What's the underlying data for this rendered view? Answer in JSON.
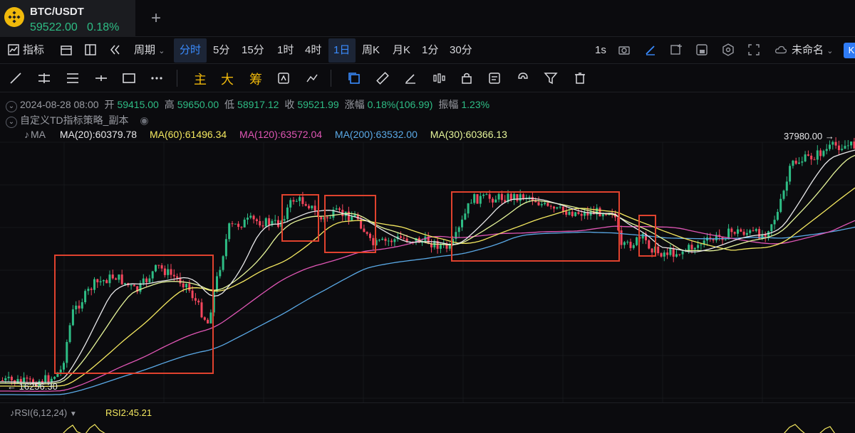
{
  "tab": {
    "symbol": "BTC/USDT",
    "price": "59522.00",
    "change": "0.18%",
    "add_label": "+"
  },
  "toolbar1": {
    "indicators": "指标",
    "period": "周期",
    "intervals": [
      "分时",
      "5分",
      "15分",
      "1时",
      "4时",
      "1日",
      "周K",
      "月K",
      "1分",
      "30分"
    ],
    "active_interval": "1日",
    "refresh": "1s",
    "layout_name": "未命名",
    "k_button": "K"
  },
  "toolbar2": {
    "main": "主",
    "big": "大",
    "chip": "筹"
  },
  "ohlc": {
    "date": "2024-08-28 08:00",
    "open_label": "开",
    "open": "59415.00",
    "high_label": "高",
    "high": "59650.00",
    "low_label": "低",
    "low": "58917.12",
    "close_label": "收",
    "close": "59521.99",
    "change_label": "涨幅",
    "change": "0.18%(106.99)",
    "amp_label": "振幅",
    "amp": "1.23%"
  },
  "strategy": {
    "name": "自定义TD指标策略_副本"
  },
  "ma": {
    "label": "MA",
    "ma20": "MA(20):60379.78",
    "ma60": "MA(60):61496.34",
    "ma120": "MA(120):63572.04",
    "ma200": "MA(200):63532.00",
    "ma30": "MA(30):60366.13",
    "colors": {
      "ma20": "#e8e8ea",
      "ma60": "#f5e960",
      "ma120": "#e056b5",
      "ma200": "#5aa9e6",
      "ma30": "#e6f59a"
    }
  },
  "price_marks": {
    "high": "37980.00 →",
    "low": "← 16256.30"
  },
  "rsi": {
    "label": "RSI(6,12,24)",
    "value": "RSI2:45.21"
  },
  "colors": {
    "up": "#2ebd85",
    "down": "#f6465d",
    "accent": "#3a8cff",
    "box": "#e0422e",
    "brand": "#f0b90b"
  }
}
